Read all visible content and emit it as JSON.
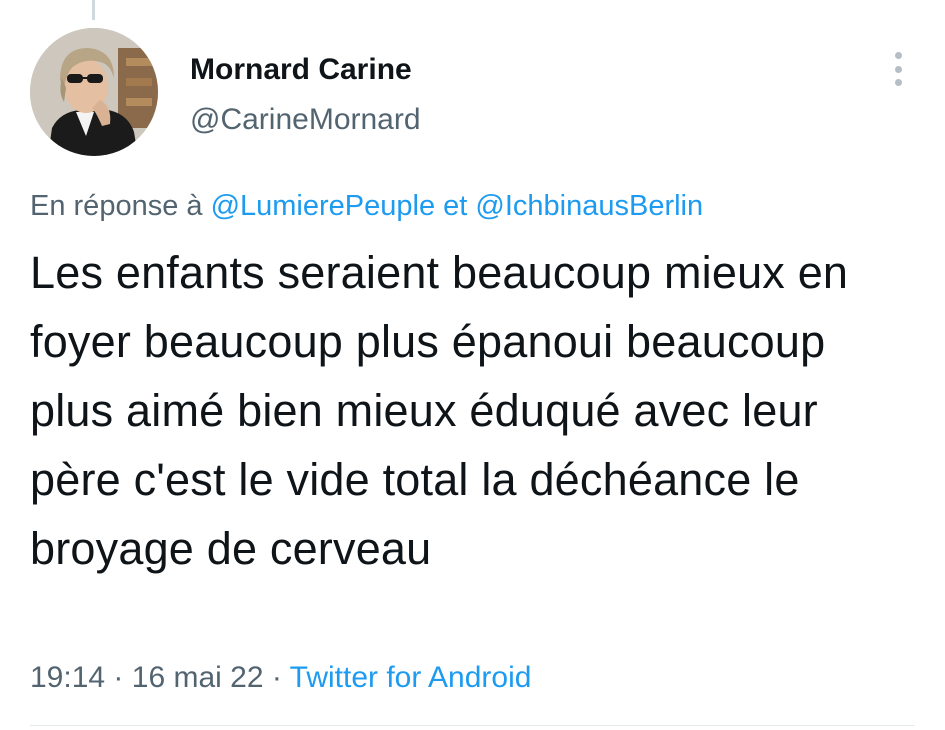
{
  "tweet": {
    "author": {
      "display_name": "Mornard Carine",
      "handle": "@CarineMornard"
    },
    "more_icon": "more-vertical-icon",
    "reply": {
      "prefix": "En réponse à",
      "mention_1": "@LumierePeuple",
      "connector": "et",
      "mention_2": "@IchbinausBerlin"
    },
    "text": "Les enfants seraient beaucoup mieux en foyer beaucoup plus épanoui beaucoup plus aimé bien mieux éduqué avec leur père c'est le vide total la déchéance le broyage de cerveau",
    "meta": {
      "time": "19:14",
      "separator": "·",
      "date": "16 mai 22",
      "source": "Twitter for Android"
    }
  },
  "colors": {
    "link": "#1d9bf0",
    "secondary_text": "#536471",
    "primary_text": "#0f1419"
  }
}
